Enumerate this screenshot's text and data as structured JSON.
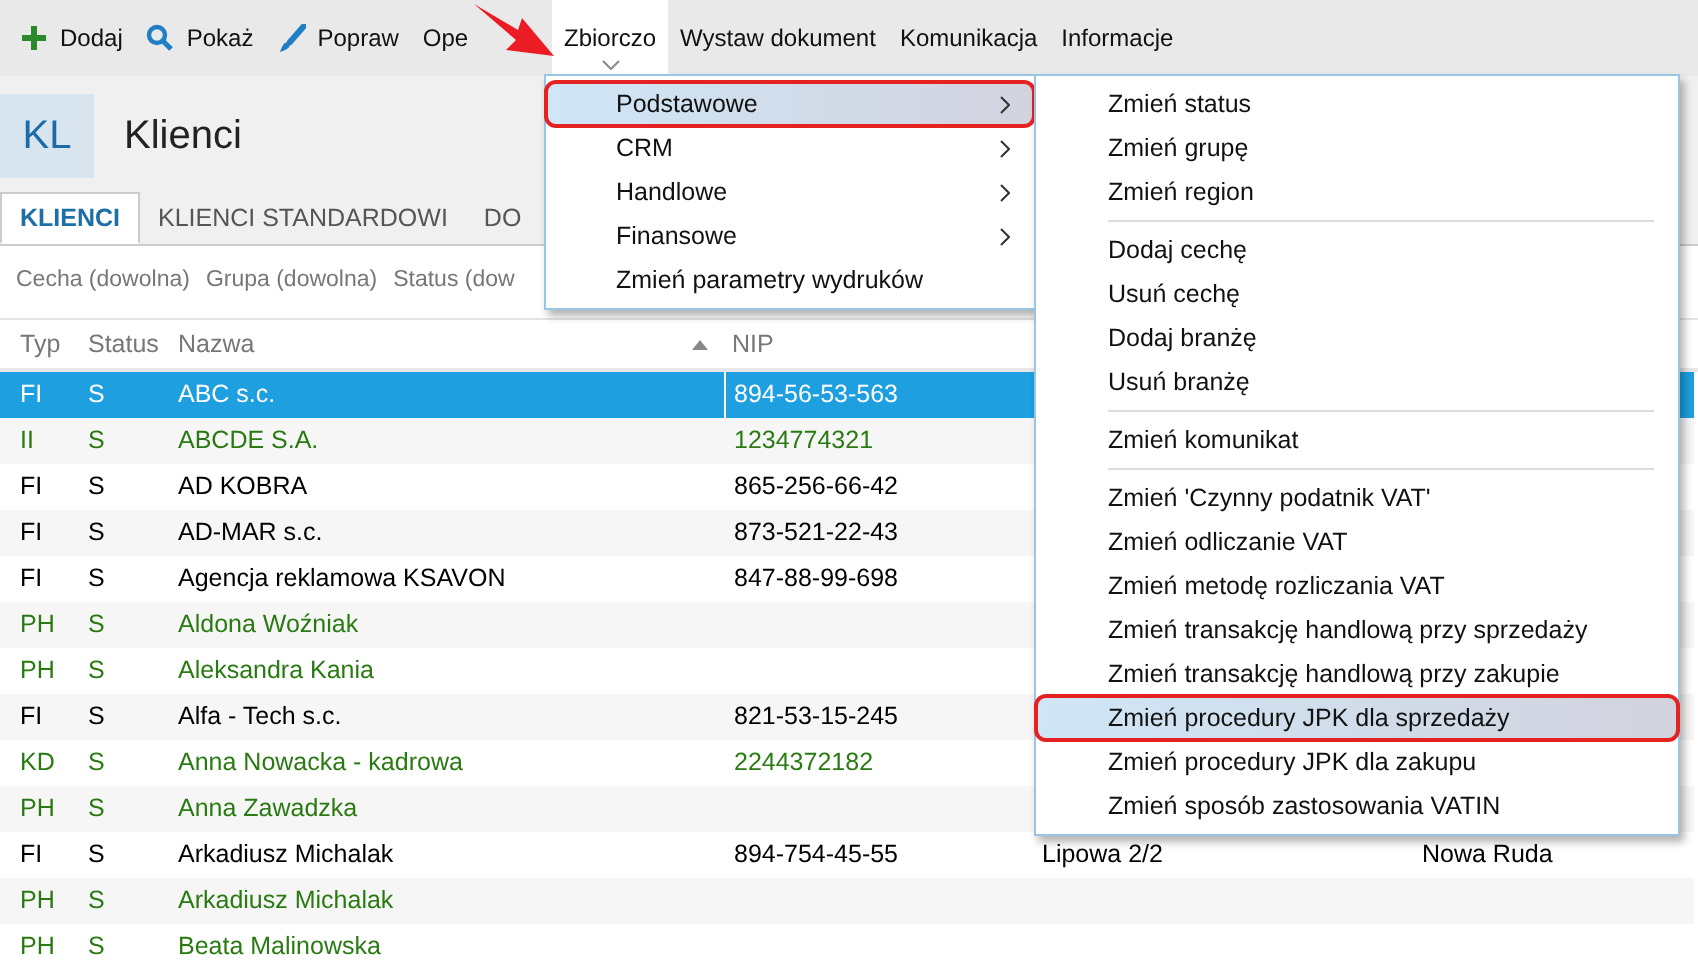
{
  "toolbar": [
    {
      "label": "Dodaj",
      "kind": "plus",
      "active": false
    },
    {
      "label": "Pokaż",
      "kind": "search",
      "active": false
    },
    {
      "label": "Popraw",
      "kind": "brush",
      "active": false
    },
    {
      "label": "Ope",
      "kind": "none",
      "active": false
    },
    {
      "label": "Zbiorczo",
      "kind": "dropdown",
      "active": true
    },
    {
      "label": "Wystaw dokument",
      "kind": "none",
      "active": false
    },
    {
      "label": "Komunikacja",
      "kind": "none",
      "active": false
    },
    {
      "label": "Informacje",
      "kind": "none",
      "active": false
    }
  ],
  "header": {
    "badge": "KL",
    "title": "Klienci"
  },
  "tabs": [
    {
      "label": "KLIENCI",
      "selected": true
    },
    {
      "label": "KLIENCI STANDARDOWI",
      "selected": false
    },
    {
      "label": "DO",
      "selected": false
    }
  ],
  "filters": [
    "Cecha (dowolna)",
    "Grupa (dowolna)",
    "Status (dow"
  ],
  "table": {
    "columns": [
      {
        "label": "Typ",
        "sorted_ascending": false
      },
      {
        "label": "Status",
        "sorted_ascending": false
      },
      {
        "label": "Nazwa",
        "sorted_ascending": true
      },
      {
        "label": "NIP",
        "sorted_ascending": false
      }
    ],
    "rows": [
      {
        "cells": [
          "FI",
          "S",
          "ABC s.c.",
          "894-56-53-563"
        ],
        "selected": true
      },
      {
        "cells": [
          "II",
          "S",
          "ABCDE S.A.",
          "1234774321"
        ],
        "selected": false,
        "color": "#2a7a12"
      },
      {
        "cells": [
          "FI",
          "S",
          "AD KOBRA",
          "865-256-66-42"
        ],
        "selected": false,
        "color": "#000000"
      },
      {
        "cells": [
          "FI",
          "S",
          "AD-MAR s.c.",
          "873-521-22-43"
        ],
        "selected": false,
        "color": "#000000"
      },
      {
        "cells": [
          "FI",
          "S",
          "Agencja reklamowa KSAVON",
          "847-88-99-698"
        ],
        "selected": false,
        "color": "#000000"
      },
      {
        "cells": [
          "PH",
          "S",
          "Aldona Woźniak"
        ],
        "selected": false,
        "color": "#2a7a12"
      },
      {
        "cells": [
          "PH",
          "S",
          "Aleksandra Kania"
        ],
        "selected": false,
        "color": "#2a7a12"
      },
      {
        "cells": [
          "FI",
          "S",
          "Alfa - Tech s.c.",
          "821-53-15-245"
        ],
        "selected": false,
        "color": "#000000"
      },
      {
        "cells": [
          "KD",
          "S",
          "Anna Nowacka - kadrowa",
          "2244372182"
        ],
        "selected": false,
        "color": "#2a7a12"
      },
      {
        "cells": [
          "PH",
          "S",
          "Anna Zawadzka"
        ],
        "selected": false,
        "color": "#2a7a12"
      },
      {
        "cells": [
          "FI",
          "S",
          "Arkadiusz Michalak",
          "894-754-45-55",
          "Lipowa  2/2",
          "Nowa Ruda"
        ],
        "selected": false,
        "color": "#000000"
      },
      {
        "cells": [
          "PH",
          "S",
          "Arkadiusz Michalak"
        ],
        "selected": false,
        "color": "#2a7a12"
      },
      {
        "cells": [
          "PH",
          "S",
          "Beata Malinowska"
        ],
        "selected": false,
        "color": "#2a7a12"
      }
    ]
  },
  "menu": [
    {
      "label": "Podstawowe",
      "submenu": true,
      "selected": true
    },
    {
      "label": "CRM",
      "submenu": true,
      "selected": false
    },
    {
      "label": "Handlowe",
      "submenu": true,
      "selected": false
    },
    {
      "label": "Finansowe",
      "submenu": true,
      "selected": false
    },
    {
      "label": "Zmień parametry wydruków",
      "submenu": false,
      "selected": false
    }
  ],
  "submenu": [
    {
      "label": "Zmień status",
      "separator_before": false,
      "selected": false
    },
    {
      "label": "Zmień grupę",
      "separator_before": false,
      "selected": false
    },
    {
      "label": "Zmień region",
      "separator_before": false,
      "selected": false
    },
    {
      "label": "Dodaj cechę",
      "separator_before": true,
      "selected": false
    },
    {
      "label": "Usuń cechę",
      "separator_before": false,
      "selected": false
    },
    {
      "label": "Dodaj branżę",
      "separator_before": false,
      "selected": false
    },
    {
      "label": "Usuń branżę",
      "separator_before": false,
      "selected": false
    },
    {
      "label": "Zmień komunikat",
      "separator_before": true,
      "selected": false
    },
    {
      "label": "Zmień 'Czynny podatnik VAT'",
      "separator_before": true,
      "selected": false
    },
    {
      "label": "Zmień odliczanie VAT",
      "separator_before": false,
      "selected": false
    },
    {
      "label": "Zmień metodę rozliczania VAT",
      "separator_before": false,
      "selected": false
    },
    {
      "label": "Zmień transakcję handlową przy sprzedaży",
      "separator_before": false,
      "selected": false
    },
    {
      "label": "Zmień transakcję handlową przy zakupie",
      "separator_before": false,
      "selected": false
    },
    {
      "label": "Zmień procedury JPK dla sprzedaży",
      "separator_before": false,
      "selected": true
    },
    {
      "label": "Zmień procedury JPK dla zakupu",
      "separator_before": false,
      "selected": false
    },
    {
      "label": "Zmień sposób zastosowania VATIN",
      "separator_before": false,
      "selected": false
    }
  ]
}
